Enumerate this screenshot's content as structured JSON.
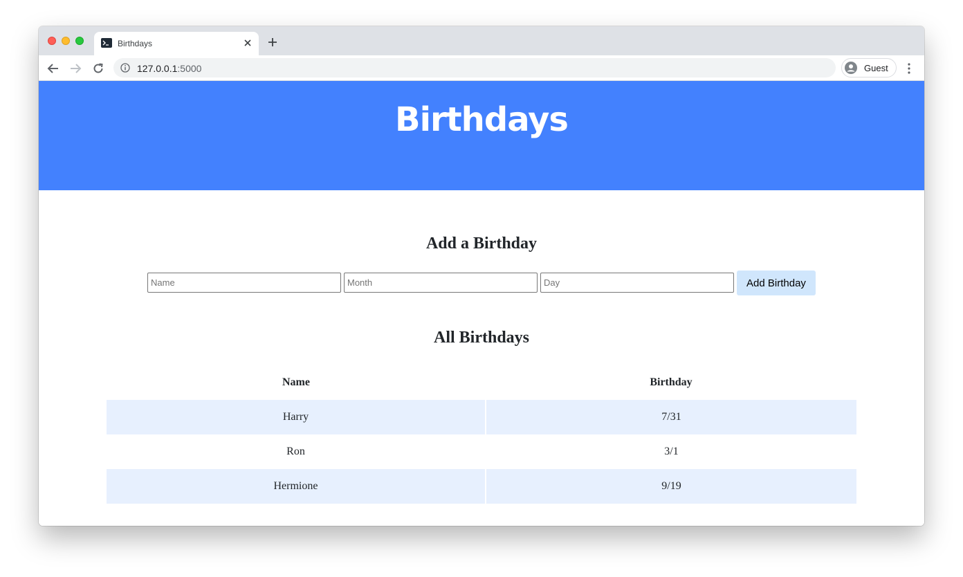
{
  "browser": {
    "tab_title": "Birthdays",
    "url_host": "127.0.0.1",
    "url_port": ":5000",
    "profile_label": "Guest"
  },
  "header": {
    "title": "Birthdays"
  },
  "add_section": {
    "title": "Add a Birthday",
    "name_placeholder": "Name",
    "month_placeholder": "Month",
    "day_placeholder": "Day",
    "submit_label": "Add Birthday"
  },
  "list_section": {
    "title": "All Birthdays",
    "columns": [
      "Name",
      "Birthday"
    ],
    "rows": [
      {
        "name": "Harry",
        "birthday": "7/31"
      },
      {
        "name": "Ron",
        "birthday": "3/1"
      },
      {
        "name": "Hermione",
        "birthday": "9/19"
      }
    ]
  },
  "colors": {
    "header_bg": "#4381fe",
    "row_stripe": "#e7f0fe",
    "button_bg": "#d0e6fc"
  }
}
